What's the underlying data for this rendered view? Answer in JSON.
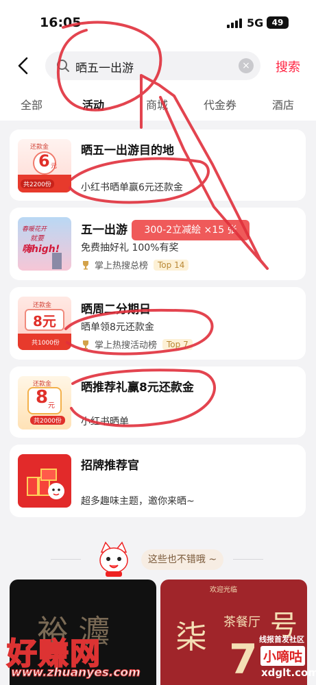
{
  "status_bar": {
    "time": "16:05",
    "network": "5G",
    "battery": "49"
  },
  "search": {
    "query": "晒五一出游",
    "clear_label": "×",
    "submit_label": "搜索"
  },
  "tabs": [
    {
      "label": "全部",
      "active": false
    },
    {
      "label": "活动",
      "active": true
    },
    {
      "label": "商城",
      "active": false
    },
    {
      "label": "代金券",
      "active": false
    },
    {
      "label": "酒店",
      "active": false
    }
  ],
  "cards": [
    {
      "title": "晒五一出游目的地",
      "subtitle": "小红书晒单赢6元还款金",
      "thumb": {
        "tag": "还款金",
        "amount": "6",
        "unit": "元",
        "note": "共2200份"
      }
    },
    {
      "title": "五一出游",
      "subtitle": "免费抽好礼 100%有奖",
      "rank_text": "掌上热搜总榜",
      "rank_badge": "Top 14",
      "thumb": {
        "line1": "春暖花开",
        "line2": "就要",
        "line3": "嗨high!"
      }
    },
    {
      "title": "晒周二分期日",
      "subtitle": "晒单领8元还款金",
      "rank_text": "掌上热搜活动榜",
      "rank_badge": "Top 7",
      "thumb": {
        "tag": "还款金",
        "amount": "8元",
        "note": "共1000份"
      }
    },
    {
      "title": "晒推荐礼赢8元还款金",
      "subtitle": "小红书晒单",
      "thumb": {
        "tag": "还款金",
        "amount": "8",
        "unit": "元",
        "note": "共2000份"
      }
    },
    {
      "title": "招牌推荐官",
      "subtitle": "超多趣味主题，邀你来晒~"
    }
  ],
  "overlay_tip": "300-2立减絵 ×15 张",
  "section_label": "这些也不错哦 ~",
  "posters": {
    "left_chars": "裕 灋",
    "right_top": "欢迎光临",
    "right_chars": "柒",
    "right_sub": "茶餐厅",
    "right_num": "7",
    "right_mark": "号"
  },
  "watermarks": {
    "left_big": "好赚网",
    "left_url": "www.zhuanyes.com",
    "right_line1": "线报首发社区",
    "right_line2": "小嘀咕",
    "right_line3": "xdglt.com"
  },
  "colors": {
    "accent": "#ff2442",
    "tip_bg": "#ef5a5a",
    "badge_bg": "#fdf1d6",
    "ink": "#e0303c"
  }
}
